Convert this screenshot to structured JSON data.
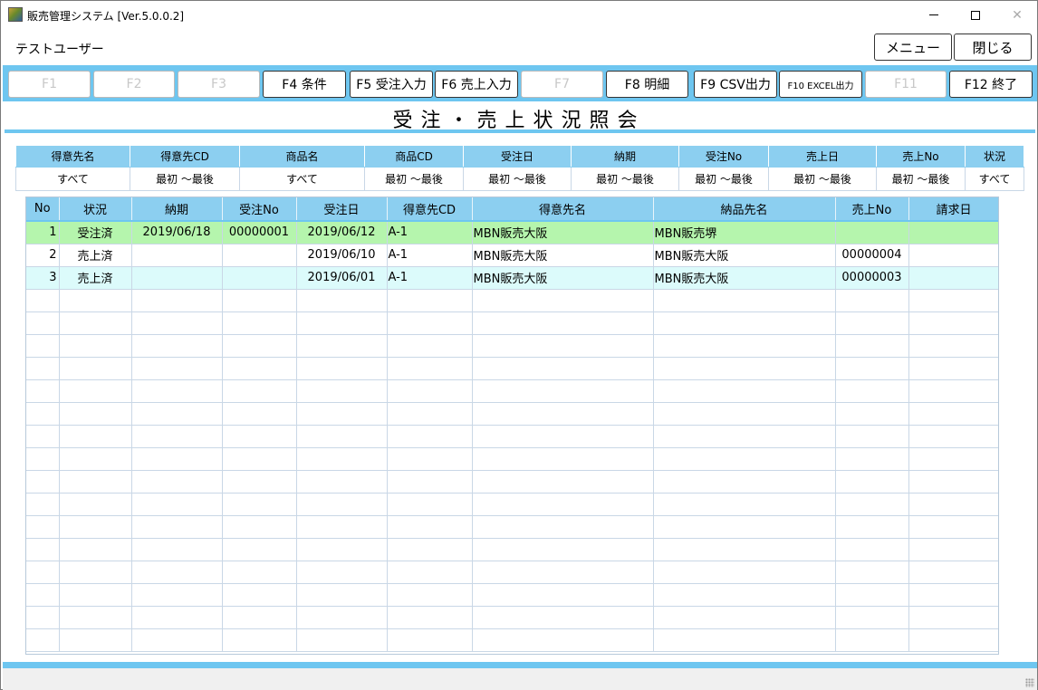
{
  "window": {
    "title": "販売管理システム [Ver.5.0.0.2]",
    "controls": {
      "minimize_icon": "minimize-icon",
      "maximize_icon": "maximize-icon",
      "close_icon": "close-icon",
      "close_glyph": "✕"
    }
  },
  "header": {
    "user_name": "テストユーザー",
    "menu_label": "メニュー",
    "close_label": "閉じる"
  },
  "function_keys": [
    {
      "label": "F1",
      "enabled": false
    },
    {
      "label": "F2",
      "enabled": false
    },
    {
      "label": "F3",
      "enabled": false
    },
    {
      "label": "F4 条件",
      "enabled": true
    },
    {
      "label": "F5 受注入力",
      "enabled": true
    },
    {
      "label": "F6 売上入力",
      "enabled": true
    },
    {
      "label": "F7",
      "enabled": false
    },
    {
      "label": "F8 明細",
      "enabled": true
    },
    {
      "label": "F9 CSV出力",
      "enabled": true
    },
    {
      "label": "F10 EXCEL出力",
      "enabled": true
    },
    {
      "label": "F11",
      "enabled": false
    },
    {
      "label": "F12 終了",
      "enabled": true
    }
  ],
  "page_title": "受注・売上状況照会",
  "conditions": {
    "headers": [
      "得意先名",
      "得意先CD",
      "商品名",
      "商品CD",
      "受注日",
      "納期",
      "受注No",
      "売上日",
      "売上No",
      "状況"
    ],
    "values": [
      "すべて",
      "最初 ～最後",
      "すべて",
      "最初 ～最後",
      "最初 ～最後",
      "最初 ～最後",
      "最初 ～最後",
      "最初 ～最後",
      "最初 ～最後",
      "すべて"
    ]
  },
  "grid": {
    "columns": [
      "No",
      "状況",
      "納期",
      "受注No",
      "受注日",
      "得意先CD",
      "得意先名",
      "納品先名",
      "売上No",
      "請求日"
    ],
    "rows": [
      [
        "1",
        "受注済",
        "2019/06/18",
        "00000001",
        "2019/06/12",
        "A-1",
        "MBN販売大阪",
        "MBN販売堺",
        "",
        ""
      ],
      [
        "2",
        "売上済",
        "",
        "",
        "2019/06/10",
        "A-1",
        "MBN販売大阪",
        "MBN販売大阪",
        "00000004",
        ""
      ],
      [
        "3",
        "売上済",
        "",
        "",
        "2019/06/01",
        "A-1",
        "MBN販売大阪",
        "MBN販売大阪",
        "00000003",
        ""
      ]
    ],
    "row_styles": [
      "green",
      "white",
      "cyan"
    ],
    "empty_rows": 16
  },
  "colors": {
    "accent": "#6ec6f0",
    "header_bg": "#8ccff0",
    "row_ordered": "#b5f5ad",
    "row_alt": "#dcfbfb"
  }
}
